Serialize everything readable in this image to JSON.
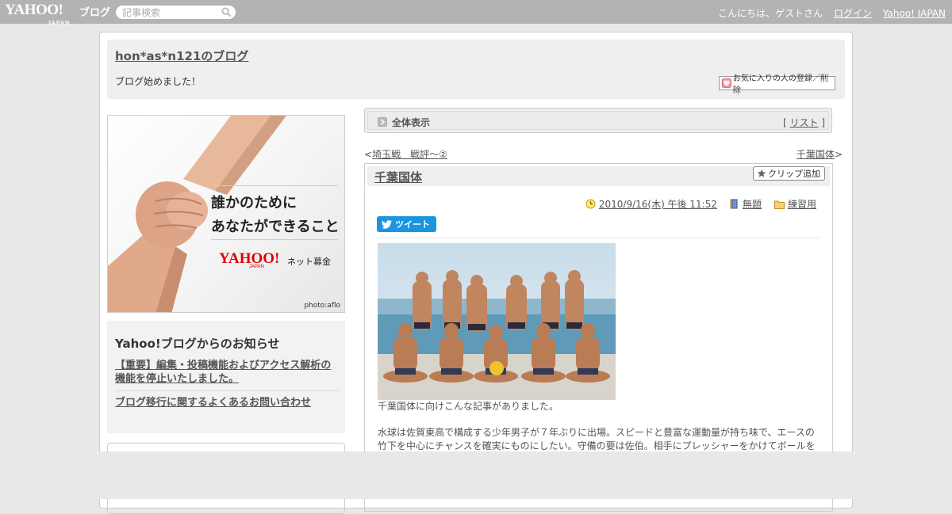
{
  "topbar": {
    "logo_text": "YAHOO!",
    "logo_sub": "JAPAN",
    "blog_label": "ブログ",
    "search_placeholder": "記事検索",
    "greeting": "こんにちは、ゲストさん",
    "login_label": "ログイン",
    "yahoo_japan_label": "Yahoo! JAPAN"
  },
  "blog": {
    "title": "hon*as*n121のブログ",
    "description": "ブログ始めました！",
    "fav_button_label": "お気に入りの人の登録／削除"
  },
  "banner": {
    "line1": "誰かのために",
    "line2": "あなたができること",
    "brand": "YAHOO!",
    "brand_sub": "JAPAN",
    "service": "ネット募金",
    "credit": "photo:aflo"
  },
  "notices": {
    "title": "Yahoo!ブログからのお知らせ",
    "items": [
      "【重要】編集・投稿機能およびアクセス解析の機能を停止いたしました。",
      "ブログ移行に関するよくあるお問い合わせ"
    ]
  },
  "view_bar": {
    "label": "全体表示",
    "list_open": "[ ",
    "list_link": "リスト",
    "list_close": " ]"
  },
  "nav": {
    "prev_arrow": "<",
    "prev_label": "埼玉戦　戦評～②",
    "next_label": "千葉国体",
    "next_arrow": ">"
  },
  "article": {
    "title": "千葉国体",
    "clip_label": "クリップ追加",
    "date": "2010/9/16(木) 午後 11:52",
    "theme": "無題",
    "category": "練習用",
    "tweet_label": "ツイート",
    "body": [
      "千葉国体に向けこんな記事がありました。",
      "",
      "水球は佐賀東高で構成する少年男子が７年ぶりに出場。スピードと豊富な運動量が持ち味で、エースの",
      "竹下を中心にチャンスを確実にものにしたい。守備の要は佐伯。相手にプレッシャーをかけてボールを"
    ]
  }
}
